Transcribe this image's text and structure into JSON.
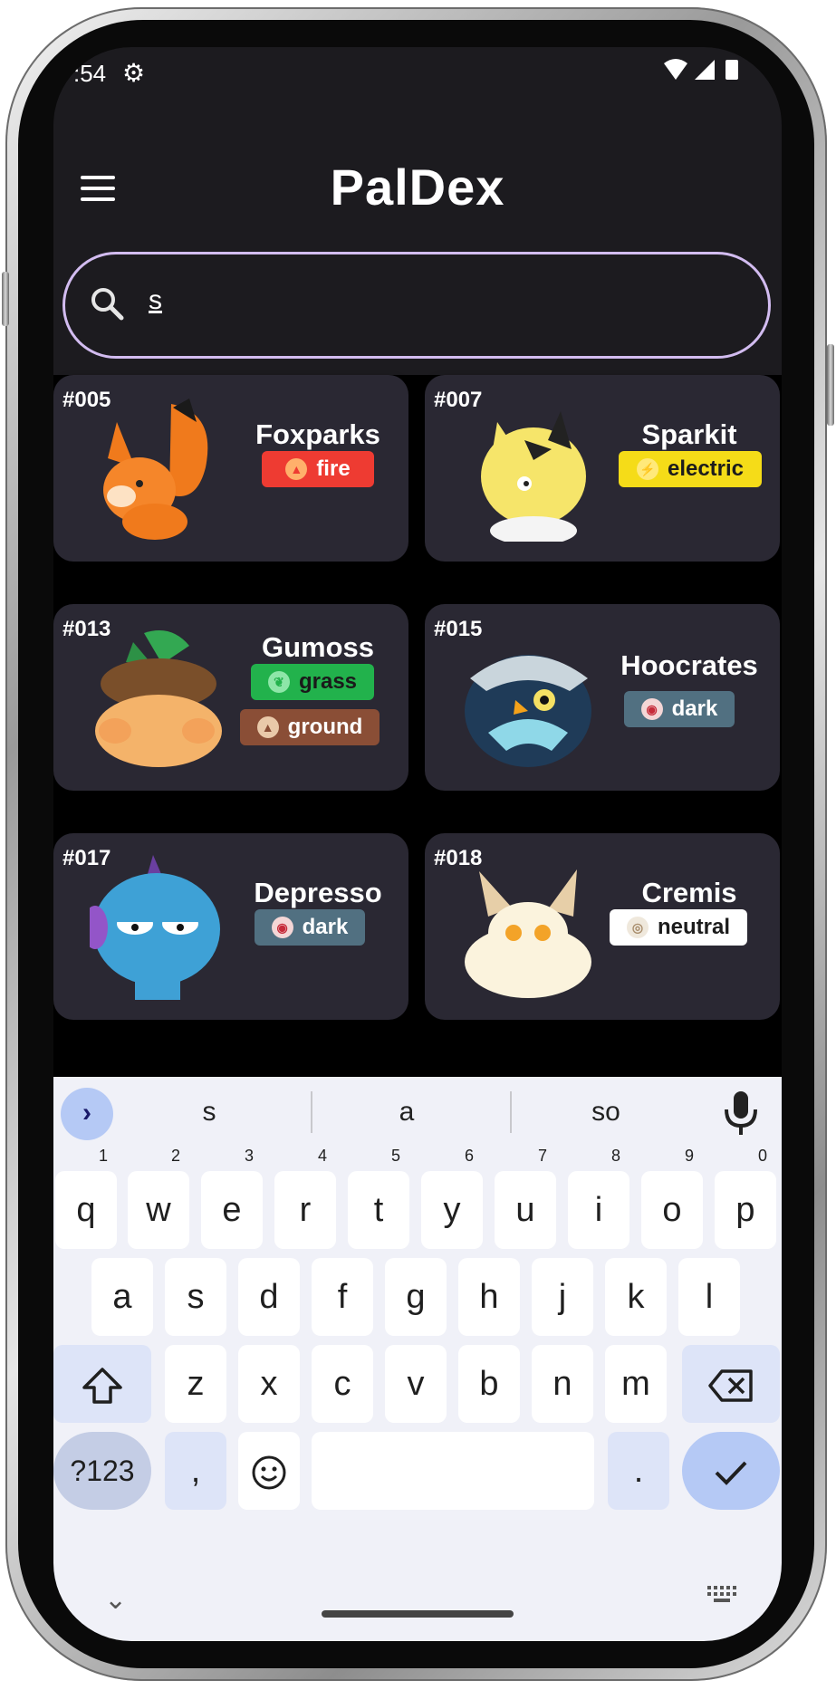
{
  "status_bar": {
    "time": ":54"
  },
  "app": {
    "title": "PalDex"
  },
  "search": {
    "value": "s"
  },
  "pals": [
    {
      "number": "#005",
      "name": "Foxparks",
      "types": [
        {
          "label": "fire",
          "color": "#ee3b32"
        }
      ]
    },
    {
      "number": "#007",
      "name": "Sparkit",
      "types": [
        {
          "label": "electric",
          "color": "#f5dc18"
        }
      ]
    },
    {
      "number": "#013",
      "name": "Gumoss",
      "types": [
        {
          "label": "grass",
          "color": "#22b24c"
        },
        {
          "label": "ground",
          "color": "#8a4e36"
        }
      ]
    },
    {
      "number": "#015",
      "name": "Hoocrates",
      "types": [
        {
          "label": "dark",
          "color": "#517081"
        }
      ]
    },
    {
      "number": "#017",
      "name": "Depresso",
      "types": [
        {
          "label": "dark",
          "color": "#517081"
        }
      ]
    },
    {
      "number": "#018",
      "name": "Cremis",
      "types": [
        {
          "label": "neutral",
          "color": "#ffffff"
        }
      ]
    }
  ],
  "keyboard": {
    "suggestions": [
      "s",
      "a",
      "so"
    ],
    "row1": [
      {
        "key": "q",
        "hint": "1"
      },
      {
        "key": "w",
        "hint": "2"
      },
      {
        "key": "e",
        "hint": "3"
      },
      {
        "key": "r",
        "hint": "4"
      },
      {
        "key": "t",
        "hint": "5"
      },
      {
        "key": "y",
        "hint": "6"
      },
      {
        "key": "u",
        "hint": "7"
      },
      {
        "key": "i",
        "hint": "8"
      },
      {
        "key": "o",
        "hint": "9"
      },
      {
        "key": "p",
        "hint": "0"
      }
    ],
    "row2": [
      "a",
      "s",
      "d",
      "f",
      "g",
      "h",
      "j",
      "k",
      "l"
    ],
    "row3": [
      "z",
      "x",
      "c",
      "v",
      "b",
      "n",
      "m"
    ],
    "bottom": {
      "symbols": "?123",
      "comma": ",",
      "period": "."
    }
  },
  "icons": [
    "menu-icon",
    "search-icon",
    "gear-icon",
    "wifi-icon",
    "signal-icon",
    "battery-icon",
    "mic-icon",
    "shift-icon",
    "backspace-icon",
    "emoji-icon",
    "check-icon",
    "chevron-right-icon",
    "chevron-down-icon",
    "keyboard-icon"
  ],
  "colors": {
    "accent": "#d2bcf0",
    "card": "#2a2833",
    "appbar": "#1c1b1f",
    "keyboard_bg": "#f0f1f8",
    "enter_key": "#b5c9f5"
  }
}
